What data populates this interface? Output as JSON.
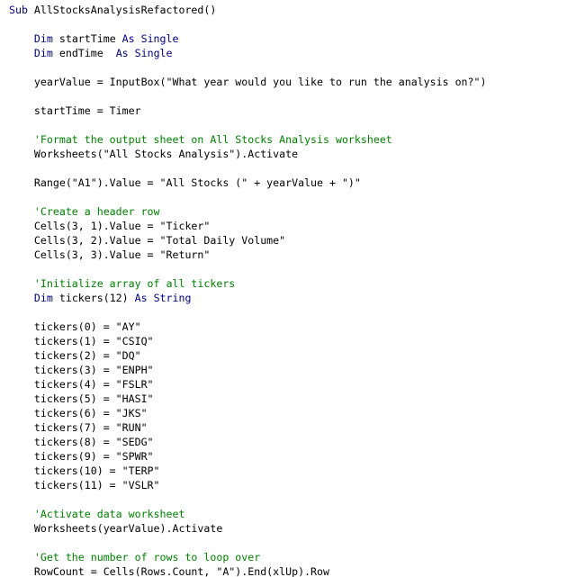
{
  "editor": {
    "colors": {
      "background": "#ffffff",
      "keyword": "#00007f",
      "comment": "#007f00",
      "text": "#000000"
    },
    "caret": {
      "line": 37,
      "after_text": "RowCount = Cells(Rows.Count, \"A\").En"
    },
    "lines": [
      {
        "tokens": [
          {
            "t": "Sub",
            "c": "kw"
          },
          {
            "t": " AllStocksAnalysisRefactored()"
          }
        ]
      },
      {
        "tokens": []
      },
      {
        "tokens": [
          {
            "t": "    "
          },
          {
            "t": "Dim",
            "c": "kw"
          },
          {
            "t": " startTime "
          },
          {
            "t": "As Single",
            "c": "kw"
          }
        ]
      },
      {
        "tokens": [
          {
            "t": "    "
          },
          {
            "t": "Dim",
            "c": "kw"
          },
          {
            "t": " endTime  "
          },
          {
            "t": "As Single",
            "c": "kw"
          }
        ]
      },
      {
        "tokens": []
      },
      {
        "tokens": [
          {
            "t": "    yearValue = InputBox(\"What year would you like to run the analysis on?\")"
          }
        ]
      },
      {
        "tokens": []
      },
      {
        "tokens": [
          {
            "t": "    startTime = Timer"
          }
        ]
      },
      {
        "tokens": []
      },
      {
        "tokens": [
          {
            "t": "    "
          },
          {
            "t": "'Format the output sheet on All Stocks Analysis worksheet",
            "c": "cm"
          }
        ]
      },
      {
        "tokens": [
          {
            "t": "    Worksheets(\"All Stocks Analysis\").Activate"
          }
        ]
      },
      {
        "tokens": []
      },
      {
        "tokens": [
          {
            "t": "    Range(\"A1\").Value = \"All Stocks (\" + yearValue + \")\""
          }
        ]
      },
      {
        "tokens": []
      },
      {
        "tokens": [
          {
            "t": "    "
          },
          {
            "t": "'Create a header row",
            "c": "cm"
          }
        ]
      },
      {
        "tokens": [
          {
            "t": "    Cells(3, 1).Value = \"Ticker\""
          }
        ]
      },
      {
        "tokens": [
          {
            "t": "    Cells(3, 2).Value = \"Total Daily Volume\""
          }
        ]
      },
      {
        "tokens": [
          {
            "t": "    Cells(3, 3).Value = \"Return\""
          }
        ]
      },
      {
        "tokens": []
      },
      {
        "tokens": [
          {
            "t": "    "
          },
          {
            "t": "'Initialize array of all tickers",
            "c": "cm"
          }
        ]
      },
      {
        "tokens": [
          {
            "t": "    "
          },
          {
            "t": "Dim",
            "c": "kw"
          },
          {
            "t": " tickers(12) "
          },
          {
            "t": "As String",
            "c": "kw"
          }
        ]
      },
      {
        "tokens": []
      },
      {
        "tokens": [
          {
            "t": "    tickers(0) = \"AY\""
          }
        ]
      },
      {
        "tokens": [
          {
            "t": "    tickers(1) = \"CSIQ\""
          }
        ]
      },
      {
        "tokens": [
          {
            "t": "    tickers(2) = \"DQ\""
          }
        ]
      },
      {
        "tokens": [
          {
            "t": "    tickers(3) = \"ENPH\""
          }
        ]
      },
      {
        "tokens": [
          {
            "t": "    tickers(4) = \"FSLR\""
          }
        ]
      },
      {
        "tokens": [
          {
            "t": "    tickers(5) = \"HASI\""
          }
        ]
      },
      {
        "tokens": [
          {
            "t": "    tickers(6) = \"JKS\""
          }
        ]
      },
      {
        "tokens": [
          {
            "t": "    tickers(7) = \"RUN\""
          }
        ]
      },
      {
        "tokens": [
          {
            "t": "    tickers(8) = \"SEDG\""
          }
        ]
      },
      {
        "tokens": [
          {
            "t": "    tickers(9) = \"SPWR\""
          }
        ]
      },
      {
        "tokens": [
          {
            "t": "    tickers(10) = \"TERP\""
          }
        ]
      },
      {
        "tokens": [
          {
            "t": "    tickers(11) = \"VSLR\""
          }
        ]
      },
      {
        "tokens": []
      },
      {
        "tokens": [
          {
            "t": "    "
          },
          {
            "t": "'Activate data worksheet",
            "c": "cm"
          }
        ]
      },
      {
        "tokens": [
          {
            "t": "    Worksheets(yearValue).Activate"
          }
        ]
      },
      {
        "tokens": []
      },
      {
        "tokens": [
          {
            "t": "    "
          },
          {
            "t": "'Get the number of rows to loop over",
            "c": "cm"
          }
        ]
      },
      {
        "tokens": [
          {
            "t": "    RowCount = Cells(Rows.Count, \"A\").End(xlUp).Row"
          }
        ]
      }
    ]
  }
}
